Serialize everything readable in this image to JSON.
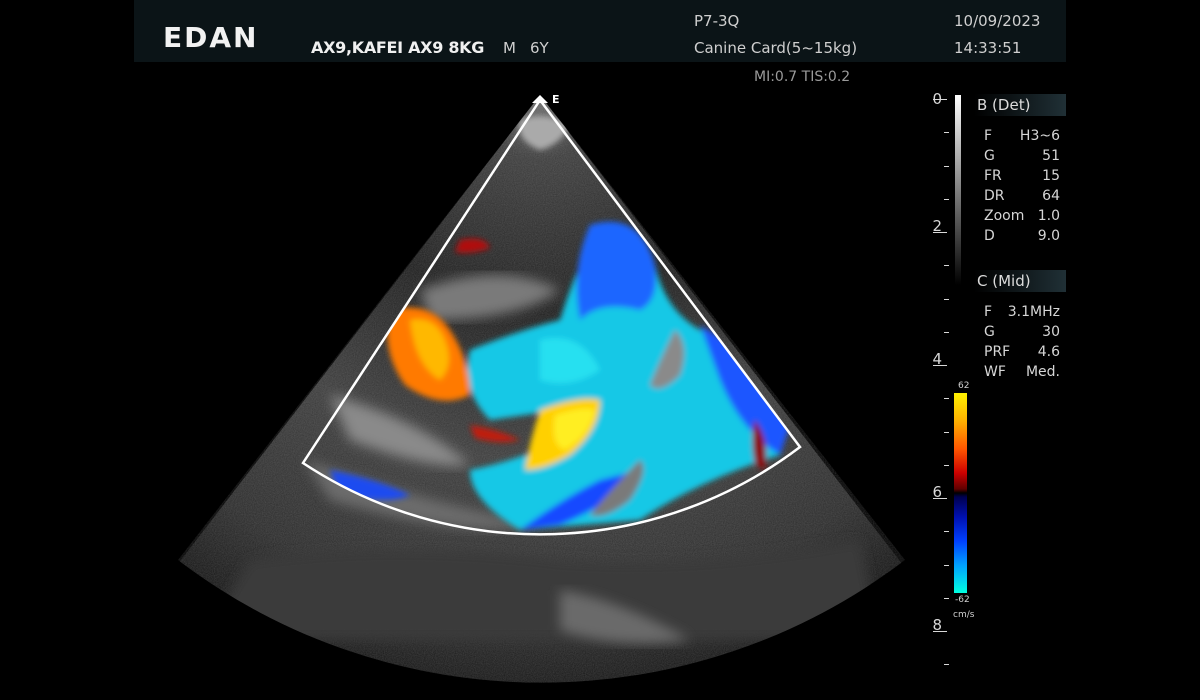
{
  "header": {
    "logo": "EDAN",
    "patient": "AX9,KAFEI AX9 8KG",
    "sex": "M",
    "age": "6Y",
    "probe": "P7-3Q",
    "preset": "Canine Card(5~15kg)",
    "date": "10/09/2023",
    "time": "14:33:51",
    "mi_tis": "MI:0.7 TIS:0.2"
  },
  "marker": "E",
  "b_mode": {
    "title": "B (Det)",
    "params": [
      {
        "k": "F",
        "v": "H3~6"
      },
      {
        "k": "G",
        "v": "51"
      },
      {
        "k": "FR",
        "v": "15"
      },
      {
        "k": "DR",
        "v": "64"
      },
      {
        "k": "Zoom",
        "v": "1.0"
      },
      {
        "k": "D",
        "v": "9.0"
      }
    ]
  },
  "c_mode": {
    "title": "C (Mid)",
    "params": [
      {
        "k": "F",
        "v": "3.1MHz"
      },
      {
        "k": "G",
        "v": "30"
      },
      {
        "k": "PRF",
        "v": "4.6"
      },
      {
        "k": "WF",
        "v": "Med."
      }
    ]
  },
  "depth_scale": [
    "0",
    "2",
    "4",
    "6",
    "8"
  ],
  "color_bar": {
    "max": "62",
    "min": "-62",
    "unit": "cm/s"
  }
}
